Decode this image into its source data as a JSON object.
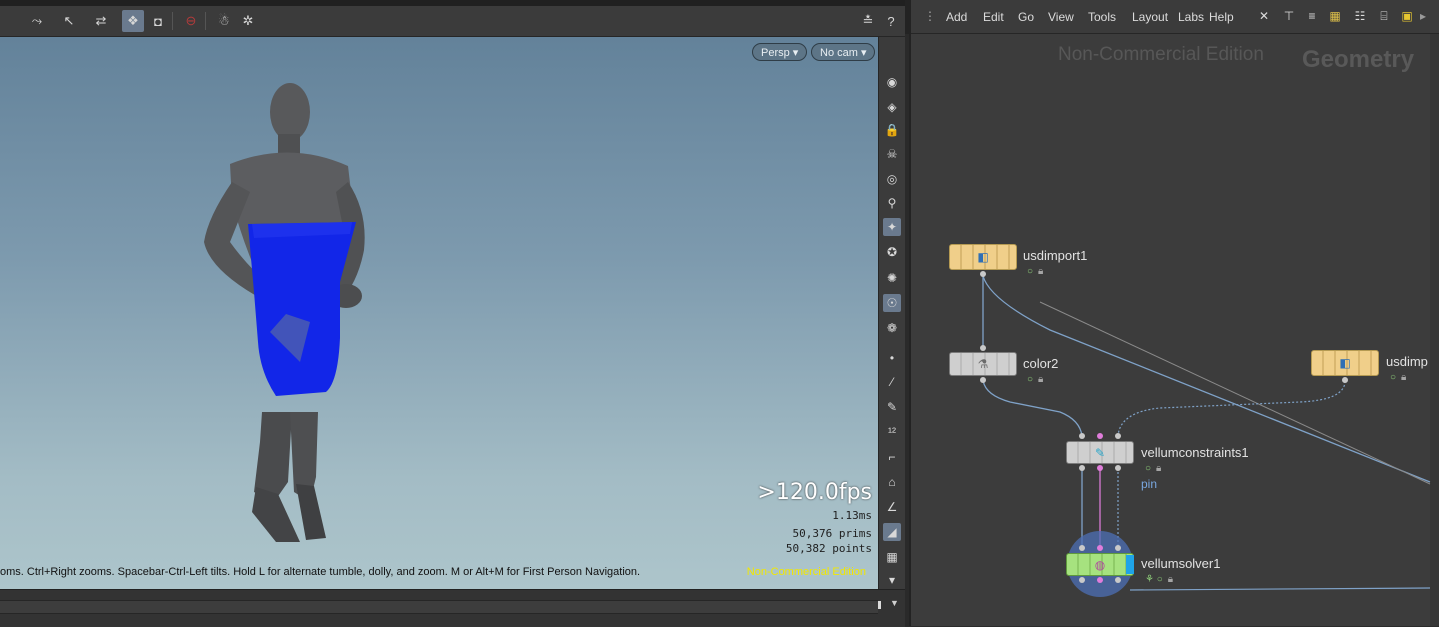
{
  "viewport": {
    "toolbar": {
      "buttons": [
        {
          "name": "select-mode-icon",
          "glyph": "⤳"
        },
        {
          "name": "move-tool-icon",
          "glyph": "↖"
        },
        {
          "name": "transform-tool-icon",
          "glyph": "⇄"
        },
        {
          "name": "snapping-icon",
          "glyph": "❖"
        },
        {
          "name": "secure-selection-icon",
          "glyph": "◘"
        },
        {
          "name": "stop-icon",
          "glyph": "⊖"
        },
        {
          "name": "render-icon",
          "glyph": "☃"
        },
        {
          "name": "settings-gear-icon",
          "glyph": "✲"
        },
        {
          "name": "display-options-icon",
          "glyph": "≛"
        },
        {
          "name": "help-icon",
          "glyph": "?"
        }
      ]
    },
    "persp_label": "Persp ▾",
    "camera_label": "No cam ▾",
    "fps": ">120.0fps",
    "frame_time": "1.13ms",
    "prims": "50,376  prims",
    "points": "50,382 points",
    "hint": "oms. Ctrl+Right zooms. Spacebar-Ctrl-Left tilts. Hold L for alternate tumble, dolly, and zoom. M or Alt+M for First Person Navigation.",
    "watermark": "Non-Commercial Edition",
    "sidebar_icons": [
      "eye-icon",
      "visibility-icon",
      "lock-icon",
      "ghost-icon",
      "shading-icon",
      "light-icon",
      "headlight-icon",
      "lights-icon",
      "material-icon",
      "camera-icon",
      "display-options-icon",
      "point-icon",
      "brush-icon",
      "pen-icon",
      "number-12-icon",
      "paint-icon",
      "paint-fill-icon",
      "angle-icon",
      "visualize-icon",
      "checker-icon",
      "scroll-down-icon"
    ],
    "sidebar_glyphs": [
      "◉",
      "◈",
      "🔒",
      "☠",
      "◎",
      "⚲",
      "✦",
      "✪",
      "✺",
      "☉",
      "❁",
      "•",
      "⁄",
      "✎",
      "¹²",
      "⌐",
      "⌂",
      "∠",
      "◢",
      "▦",
      "▾"
    ],
    "figure_color": "#545658",
    "cloth_color": "#1226e8"
  },
  "network": {
    "menu": [
      "Add",
      "Edit",
      "Go",
      "View",
      "Tools",
      "Layout",
      "Labs",
      "Help"
    ],
    "menu_icons": [
      "✕",
      "⊤",
      "≡",
      "▦",
      "☷",
      "⌸",
      "▣",
      "▸"
    ],
    "edition_watermark": "Non-Commercial Edition",
    "context_label": "Geometry",
    "nodes": {
      "usdimport1": {
        "label": "usdimport1",
        "flags": "○"
      },
      "color2": {
        "label": "color2",
        "flags": "○"
      },
      "usdimport2": {
        "label": "usdimp",
        "flags": "○"
      },
      "vellumconstraints1": {
        "label": "vellumconstraints1",
        "flags": "○",
        "tag": "pin"
      },
      "vellumsolver1": {
        "label": "vellumsolver1",
        "flags": "⚘ ○"
      }
    },
    "wire_color": "#7fa2c8",
    "wire_color_pink": "#d97ad5"
  }
}
